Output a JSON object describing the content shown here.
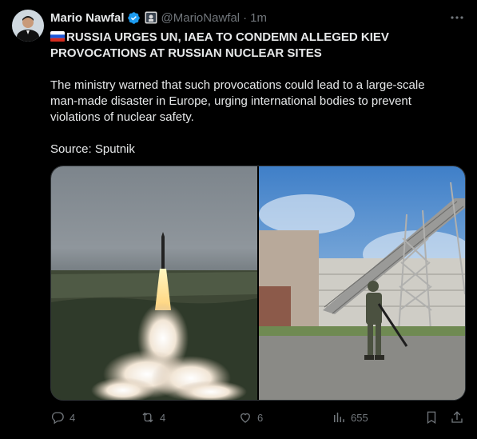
{
  "tweet": {
    "author_name": "Mario Nawfal",
    "handle": "@MarioNawfal",
    "separator": "·",
    "time": "1m",
    "headline": "RUSSIA URGES UN, IAEA TO CONDEMN ALLEGED KIEV PROVOCATIONS AT RUSSIAN NUCLEAR SITES",
    "body": "The ministry warned that such provocations could lead to a large-scale man-made disaster in Europe, urging international bodies to prevent violations of nuclear safety.",
    "source": "Source: Sputnik"
  },
  "actions": {
    "replies": "4",
    "reposts": "4",
    "likes": "6",
    "views": "655"
  },
  "colors": {
    "background": "#000000",
    "text": "#e7e9ea",
    "muted": "#71767b",
    "verified": "#1d9bf0"
  }
}
